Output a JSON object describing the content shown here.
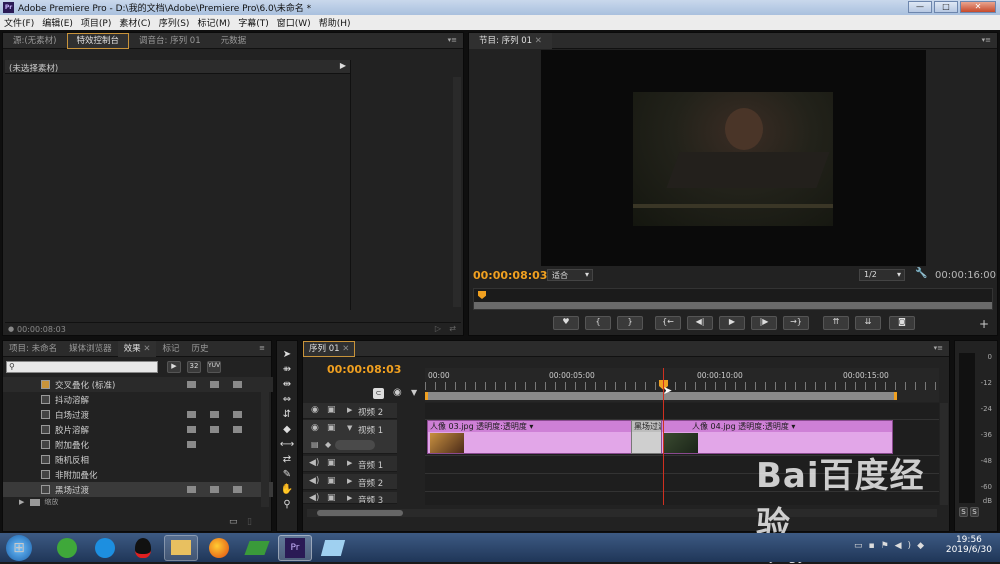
{
  "window": {
    "title": "Adobe Premiere Pro - D:\\我的文档\\Adobe\\Premiere Pro\\6.0\\未命名 *",
    "logo": "Pr"
  },
  "menu": [
    "文件(F)",
    "编辑(E)",
    "项目(P)",
    "素材(C)",
    "序列(S)",
    "标记(M)",
    "字幕(T)",
    "窗口(W)",
    "帮助(H)"
  ],
  "source_panel": {
    "tabs": [
      "源:(无素材)",
      "特效控制台",
      "调音台: 序列 01",
      "元数据"
    ],
    "no_clip": "(未选择素材)",
    "timecode": "00:00:08:03"
  },
  "program_panel": {
    "tab": "节目: 序列 01",
    "timecode": "00:00:08:03",
    "fit": "适合",
    "quality": "1/2",
    "duration": "00:00:16:00"
  },
  "project_panel": {
    "tabs": [
      "项目: 未命名",
      "媒体浏览器",
      "效果",
      "标记",
      "历史"
    ],
    "badges": [
      "32",
      "YUV"
    ],
    "effects": [
      {
        "name": "交叉叠化 (标准)",
        "badges": 3
      },
      {
        "name": "抖动溶解",
        "badges": 0
      },
      {
        "name": "白场过渡",
        "badges": 3
      },
      {
        "name": "胶片溶解",
        "badges": 3
      },
      {
        "name": "附加叠化",
        "badges": 1
      },
      {
        "name": "随机反相",
        "badges": 0
      },
      {
        "name": "非附加叠化",
        "badges": 0
      },
      {
        "name": "黑场过渡",
        "badges": 3
      }
    ],
    "folder": "缩放"
  },
  "timeline": {
    "tab": "序列 01",
    "timecode": "00:00:08:03",
    "ruler": [
      "00:00",
      "00:00:05:00",
      "00:00:10:00",
      "00:00:15:00"
    ],
    "tracks": {
      "v2": "视频 2",
      "v1": "视频 1",
      "a1": "音频 1",
      "a2": "音频 2",
      "a3": "音频 3"
    },
    "clips": [
      {
        "label": "人像 03.jpg 透明度:透明度 ▾"
      },
      {
        "label": "黑场过渡"
      },
      {
        "label": "人像 04.jpg 透明度:透明度 ▾"
      }
    ]
  },
  "meter": {
    "labels": [
      "0",
      "-12",
      "-24",
      "-36",
      "-48",
      "-60",
      "dB"
    ],
    "solo": "S"
  },
  "taskbar": {
    "time": "19:56",
    "date": "2019/6/30",
    "icons": [
      "start-orb-icon",
      "360-browser-icon",
      "media-player-icon",
      "qq-icon",
      "file-explorer-icon",
      "firefox-icon",
      "camtasia-icon",
      "premiere-icon",
      "notes-icon"
    ]
  },
  "watermark": {
    "text": "Bai百度经验",
    "url": "jingyan.baidu.com"
  },
  "colors": {
    "timecode": "#f0a020",
    "clip": "#e2a6e8",
    "playhead": "#d03020"
  }
}
